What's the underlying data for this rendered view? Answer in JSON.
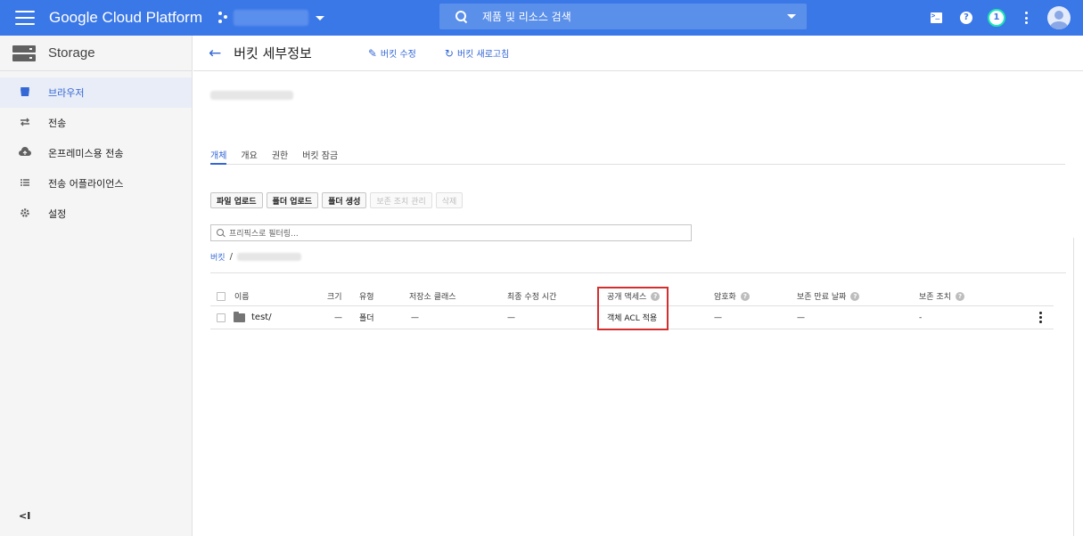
{
  "topbar": {
    "brand": "Google Cloud Platform",
    "search_placeholder": "제품 및 리소스 검색",
    "notification_count": "1"
  },
  "sidebar": {
    "title": "Storage",
    "items": [
      {
        "label": "브라우저",
        "icon": "bucket-icon"
      },
      {
        "label": "전송",
        "icon": "transfer-icon"
      },
      {
        "label": "온프레미스용 전송",
        "icon": "cloud-upload-icon"
      },
      {
        "label": "전송 어플라이언스",
        "icon": "appliance-icon"
      },
      {
        "label": "설정",
        "icon": "gear-icon"
      }
    ],
    "collapse_label": "<I"
  },
  "header": {
    "title": "버킷 세부정보",
    "edit_label": "버킷 수정",
    "refresh_label": "버킷 새로고침"
  },
  "tabs": [
    "개체",
    "개요",
    "권한",
    "버킷 잠금"
  ],
  "toolbar": {
    "upload_files": "파일 업로드",
    "upload_folder": "폴더 업로드",
    "create_folder": "폴더 생성",
    "manage_holds": "보존 조치 관리",
    "delete": "삭제"
  },
  "filter_placeholder": "프리픽스로 필터링...",
  "breadcrumb": {
    "root": "버킷",
    "separator": "/"
  },
  "table": {
    "columns": {
      "name": "이름",
      "size": "크기",
      "type": "유형",
      "storage_class": "저장소 클래스",
      "last_modified": "최종 수정 시간",
      "public_access": "공개 액세스",
      "encryption": "암호화",
      "retention_expiry": "보존 만료 날짜",
      "holds": "보존 조치"
    },
    "rows": [
      {
        "name": "test/",
        "size": "—",
        "type": "폴더",
        "storage_class": "—",
        "last_modified": "—",
        "public_access": "객체 ACL 적용",
        "encryption": "—",
        "retention_expiry": "—",
        "holds": "-"
      }
    ]
  },
  "colors": {
    "topbar": "#3b78e7",
    "accent": "#3367d6",
    "highlight": "#d32f2f"
  }
}
